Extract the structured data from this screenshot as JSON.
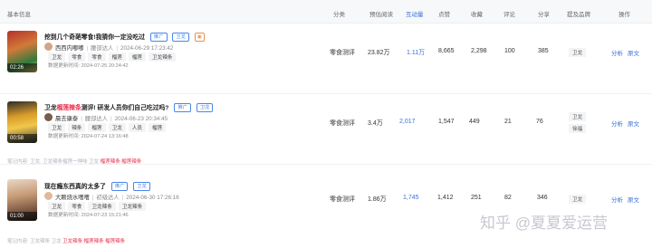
{
  "header": {
    "basic_info": "基本信息",
    "category": "分类",
    "est_reads": "预估阅读",
    "interaction": "互动量",
    "likes": "点赞",
    "collects": "收藏",
    "comments": "评论",
    "shares": "分享",
    "brands": "提及品牌",
    "actions": "操作"
  },
  "rows": [
    {
      "title": "挖到几个奇葩零食!我猜你一定没吃过",
      "tags": [
        "推广",
        "卫龙"
      ],
      "author": "西西内嘟嘟",
      "author_level": "腰部达人",
      "publish_time": "2024-06-29 17:23:42",
      "keywords": [
        "卫龙",
        "零食",
        "零食",
        "榴莲",
        "榴莲",
        "卫龙辣条"
      ],
      "updated": "数据更新时间: 2024-07-25 20:24:42",
      "duration": "02:26",
      "category": "零食测评",
      "est_reads": "23.82万",
      "interaction": "1.11万",
      "likes": "8,665",
      "collects": "2,298",
      "comments": "100",
      "shares": "385",
      "brand": "卫龙",
      "op_analyze": "分析",
      "op_source": "原文"
    },
    {
      "title_pre": "卫龙",
      "title_hl": "榴莲辣条",
      "title_post": "测评! 研发人员你们自己吃过吗?",
      "tags": [
        "推广",
        "卫龙"
      ],
      "author": "晨去康泰",
      "author_level": "腰部达人",
      "publish_time": "2024-06-23 20:34:45",
      "keywords": [
        "卫龙",
        "辣条",
        "榴莲",
        "卫龙",
        "人员",
        "榴莲"
      ],
      "updated": "数据更新时间: 2024-07-24 13:16:48",
      "duration": "00:58",
      "category": "零食测评",
      "est_reads": "3.4万",
      "interaction": "2,017",
      "likes": "1,547",
      "collects": "449",
      "comments": "21",
      "shares": "76",
      "brands": [
        "卫龙",
        "徐福"
      ],
      "op_analyze": "分析",
      "op_source": "原文",
      "note_pre": "笔记内容: ",
      "note_mid": "卫龙, 卫龙辣条榴莲一种味 卫龙",
      "note_hl": "榴莲辣条 榴莲辣条"
    },
    {
      "title": "现在瘾东西真的太多了",
      "tags": [
        "推广",
        "卫龙"
      ],
      "author": "大颗烧水嗜嗜",
      "author_level": "初级达人",
      "publish_time": "2024-06-30 17:26:16",
      "keywords": [
        "卫龙",
        "零食",
        "卫龙辣条",
        "卫龙辣条"
      ],
      "updated": "数据更新时间: 2024-07-23 15:21:46",
      "duration": "01:00",
      "category": "零食测评",
      "est_reads": "1.86万",
      "interaction": "1,745",
      "likes": "1,412",
      "collects": "251",
      "comments": "82",
      "shares": "346",
      "brand": "卫龙",
      "op_analyze": "分析",
      "op_source": "原文",
      "note_pre": "笔记内容: ",
      "note_mid": "卫龙辣条 卫龙",
      "note_hl": "卫龙辣条 榴莲辣条 榴莲辣条"
    }
  ],
  "watermark": "知乎 @夏夏爱运营"
}
